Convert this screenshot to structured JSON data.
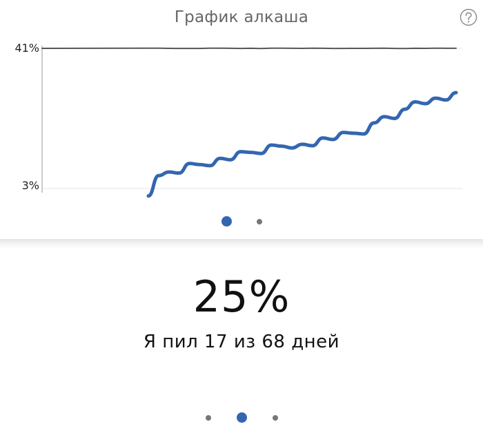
{
  "card": {
    "title": "График алкаша"
  },
  "icons": {
    "help": "help-question-icon"
  },
  "chart_data": {
    "type": "line",
    "y_ticks": [
      "41%",
      "3%"
    ],
    "ylim": [
      3,
      41
    ],
    "grid": true,
    "series": [
      {
        "values": [
          1.0,
          6.5,
          7.5,
          7.2,
          9.8,
          9.5,
          9.2,
          11.2,
          10.8,
          13.0,
          12.8,
          12.5,
          14.8,
          14.5,
          14.0,
          15.0,
          14.6,
          16.7,
          16.3,
          18.2,
          18.0,
          17.8,
          20.8,
          22.5,
          22.0,
          24.5,
          26.5,
          26.0,
          27.5,
          27.0,
          29.0
        ],
        "color": "#3466b0"
      },
      {
        "values": [
          41.0,
          41.0,
          41.0,
          41.0,
          41.0,
          41.0,
          41.0,
          41.0,
          41.0,
          41.0,
          41.0,
          41.0,
          41.0,
          41.0,
          41.0,
          41.0,
          41.0,
          41.0,
          41.0,
          41.0,
          41.0,
          41.0,
          41.0,
          41.0,
          41.0,
          41.0,
          41.0,
          41.0,
          41.0,
          41.0,
          41.0
        ],
        "color": "#555555"
      }
    ]
  },
  "chart_pager": {
    "active_index": 0,
    "count": 2
  },
  "stat": {
    "value": "25%",
    "caption": "Я пил 17 из 68 дней"
  },
  "page_pager": {
    "active_index": 1,
    "count": 3
  },
  "colors": {
    "accent": "#3466b0",
    "muted_dot": "#777777",
    "title": "#666666"
  }
}
